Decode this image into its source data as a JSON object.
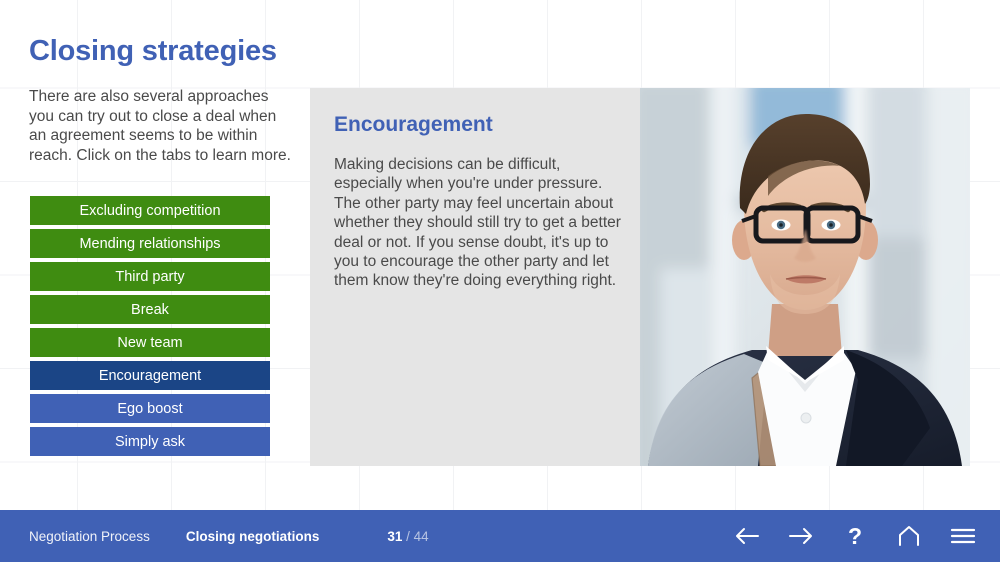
{
  "slide": {
    "title": "Closing strategies",
    "intro": "There are also several approaches you can try out to close a deal when an agreement seems to be within reach. Click on the tabs to learn more."
  },
  "tabs": [
    {
      "label": "Excluding competition",
      "state": "green"
    },
    {
      "label": "Mending relationships",
      "state": "green"
    },
    {
      "label": "Third party",
      "state": "green"
    },
    {
      "label": "Break",
      "state": "green"
    },
    {
      "label": "New team",
      "state": "green"
    },
    {
      "label": "Encouragement",
      "state": "selected"
    },
    {
      "label": "Ego boost",
      "state": "blue"
    },
    {
      "label": "Simply ask",
      "state": "blue"
    }
  ],
  "panel": {
    "heading": "Encouragement",
    "body": "Making decisions can be difficult, especially when you're under pressure. The other party may feel uncertain about whether they should still try to get a better deal or not. If you sense doubt, it's up to you to encourage the other party and let them know they're doing everything right.",
    "photo_alt": "Portrait of a man wearing glasses and a dark jacket"
  },
  "footer": {
    "breadcrumb_course": "Negotiation Process",
    "breadcrumb_section": "Closing negotiations",
    "page_current": "31",
    "page_separator": "/",
    "page_total": "44",
    "nav": [
      {
        "name": "back-arrow-icon",
        "label": "Back"
      },
      {
        "name": "forward-arrow-icon",
        "label": "Forward"
      },
      {
        "name": "question-mark-icon",
        "label": "Help"
      },
      {
        "name": "home-icon",
        "label": "Home"
      },
      {
        "name": "hamburger-menu-icon",
        "label": "Menu"
      }
    ]
  },
  "colors": {
    "accent_blue": "#4061b5",
    "selected_navy": "#1b4586",
    "tab_green": "#3f8c11",
    "panel_bg": "#e5e5e5",
    "text_gray": "#4a4a4a"
  }
}
